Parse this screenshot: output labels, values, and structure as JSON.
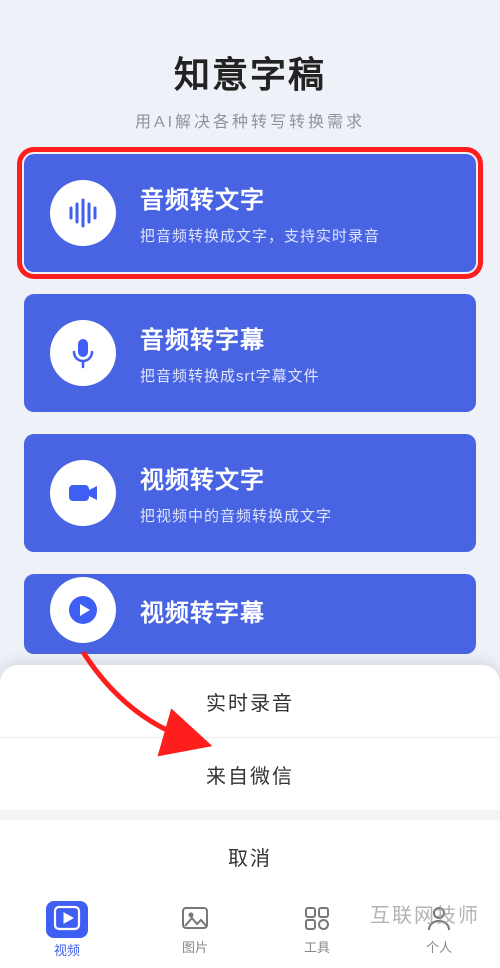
{
  "header": {
    "title": "知意字稿",
    "subtitle": "用AI解决各种转写转换需求"
  },
  "cards": [
    {
      "title": "音频转文字",
      "desc": "把音频转换成文字，支持实时录音",
      "icon": "wave-icon",
      "highlight": true
    },
    {
      "title": "音频转字幕",
      "desc": "把音频转换成srt字幕文件",
      "icon": "microphone-icon",
      "highlight": false
    },
    {
      "title": "视频转文字",
      "desc": "把视频中的音频转换成文字",
      "icon": "video-icon",
      "highlight": false
    },
    {
      "title": "视频转字幕",
      "desc": "",
      "icon": "play-icon",
      "highlight": false
    }
  ],
  "sheet": {
    "items": [
      "实时录音",
      "来自微信"
    ],
    "cancel": "取消"
  },
  "tabs": [
    {
      "label": "视频",
      "icon": "play-tab-icon",
      "active": true
    },
    {
      "label": "图片",
      "icon": "image-tab-icon",
      "active": false
    },
    {
      "label": "工具",
      "icon": "tools-tab-icon",
      "active": false
    },
    {
      "label": "个人",
      "icon": "person-tab-icon",
      "active": false
    }
  ],
  "watermark": "互联网技师",
  "colors": {
    "primary": "#4964e2",
    "highlight": "#ff1e1e"
  }
}
